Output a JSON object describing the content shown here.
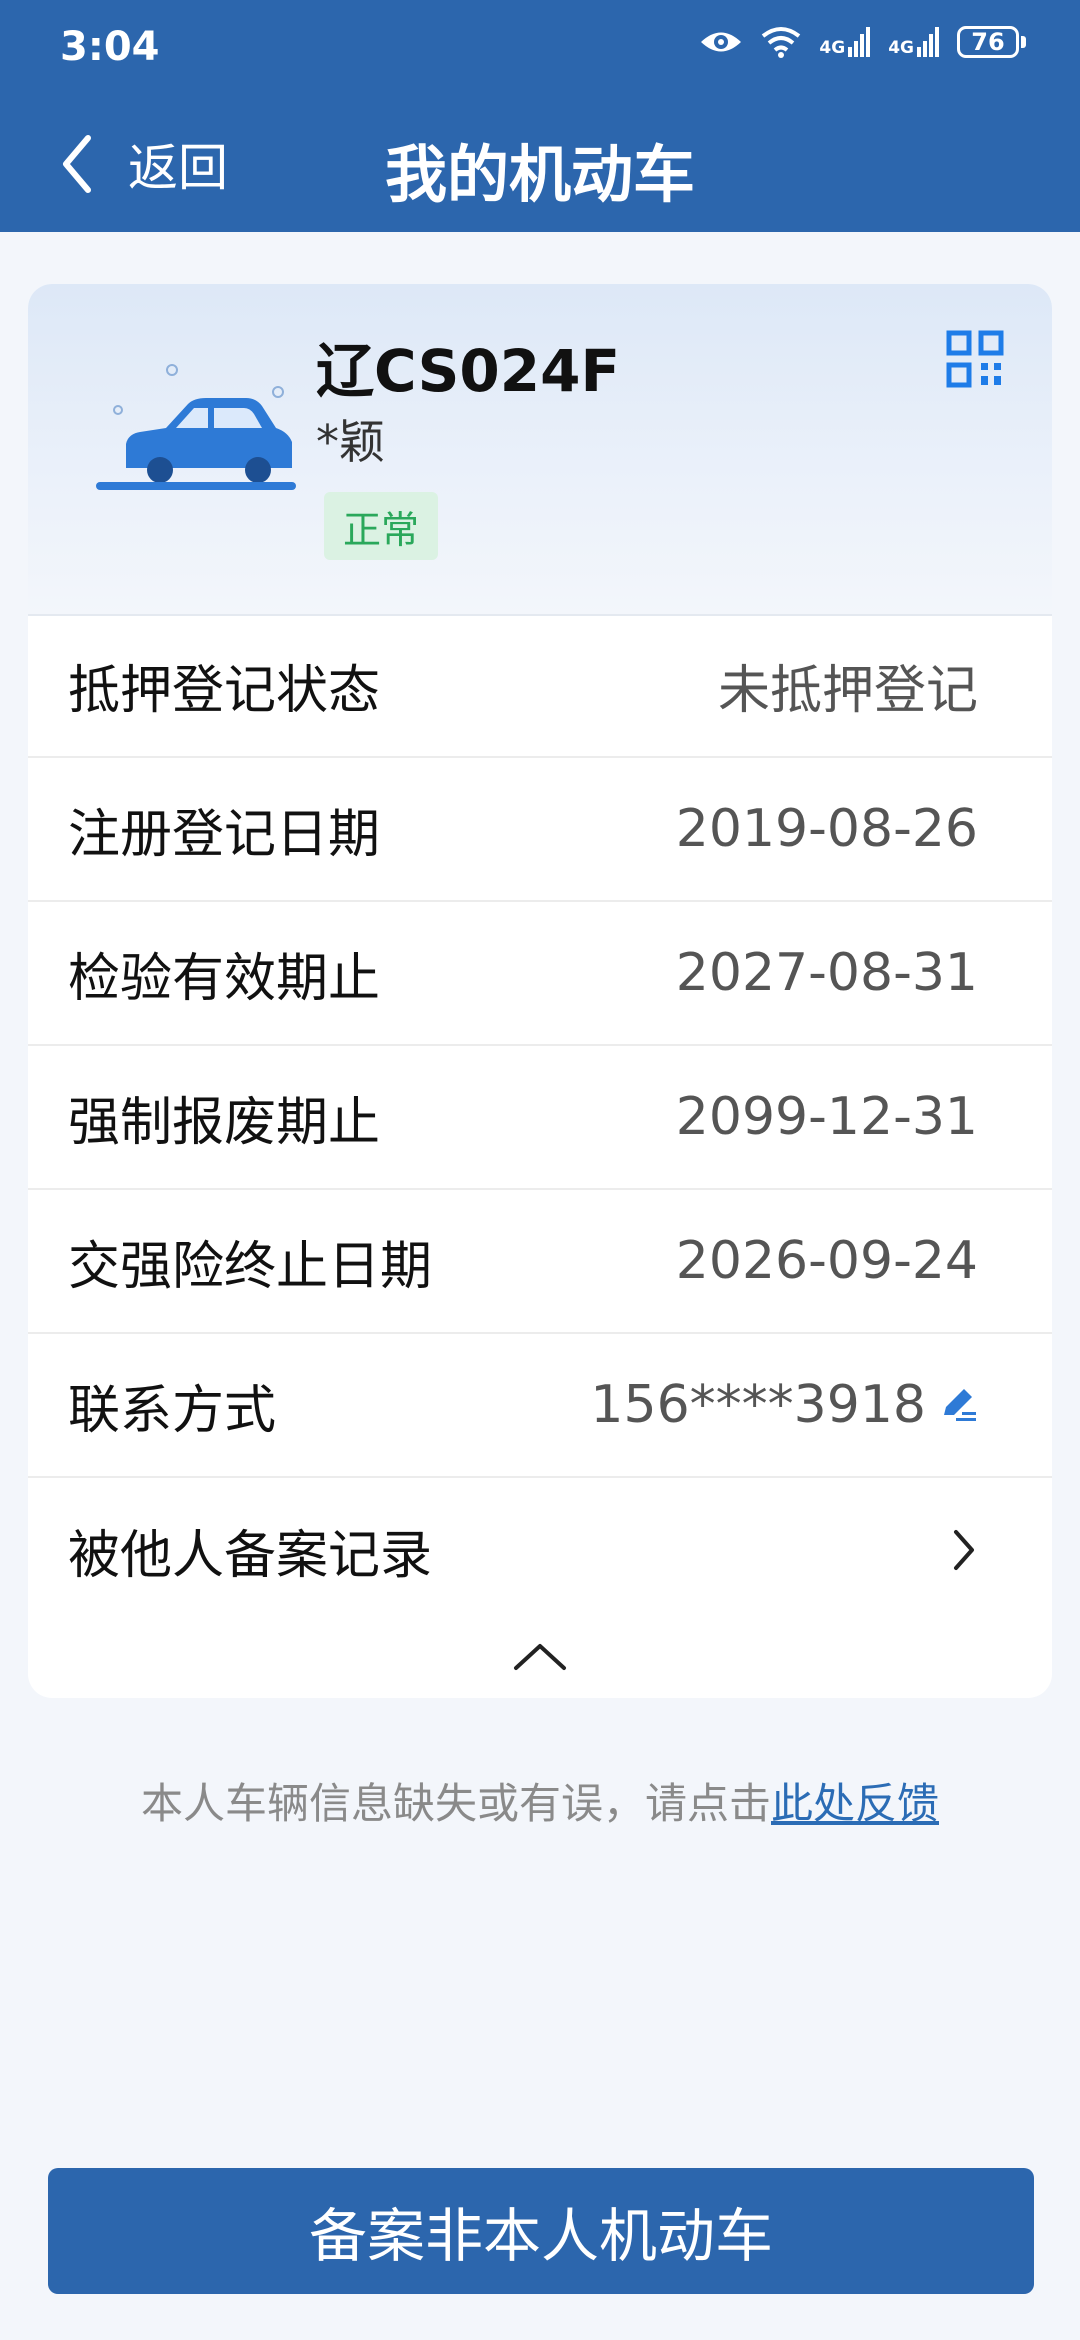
{
  "status_bar": {
    "time": "3:04",
    "network_1": "4G",
    "network_2": "4G",
    "battery": "76"
  },
  "header": {
    "back_label": "返回",
    "title": "我的机动车"
  },
  "vehicle": {
    "plate": "辽CS024F",
    "owner": "*颖",
    "status": "正常"
  },
  "details": [
    {
      "label": "抵押登记状态",
      "value": "未抵押登记"
    },
    {
      "label": "注册登记日期",
      "value": "2019-08-26"
    },
    {
      "label": "检验有效期止",
      "value": "2027-08-31"
    },
    {
      "label": "强制报废期止",
      "value": "2099-12-31"
    },
    {
      "label": "交强险终止日期",
      "value": "2026-09-24"
    },
    {
      "label": "联系方式",
      "value": "156****3918"
    },
    {
      "label": "被他人备案记录",
      "value": ""
    }
  ],
  "feedback": {
    "text": "本人车辆信息缺失或有误，请点击",
    "link": "此处反馈"
  },
  "bottom_button": "备案非本人机动车",
  "colors": {
    "brand": "#2c66ad",
    "status_green": "#2aa85b",
    "link": "#2b6cb5"
  }
}
